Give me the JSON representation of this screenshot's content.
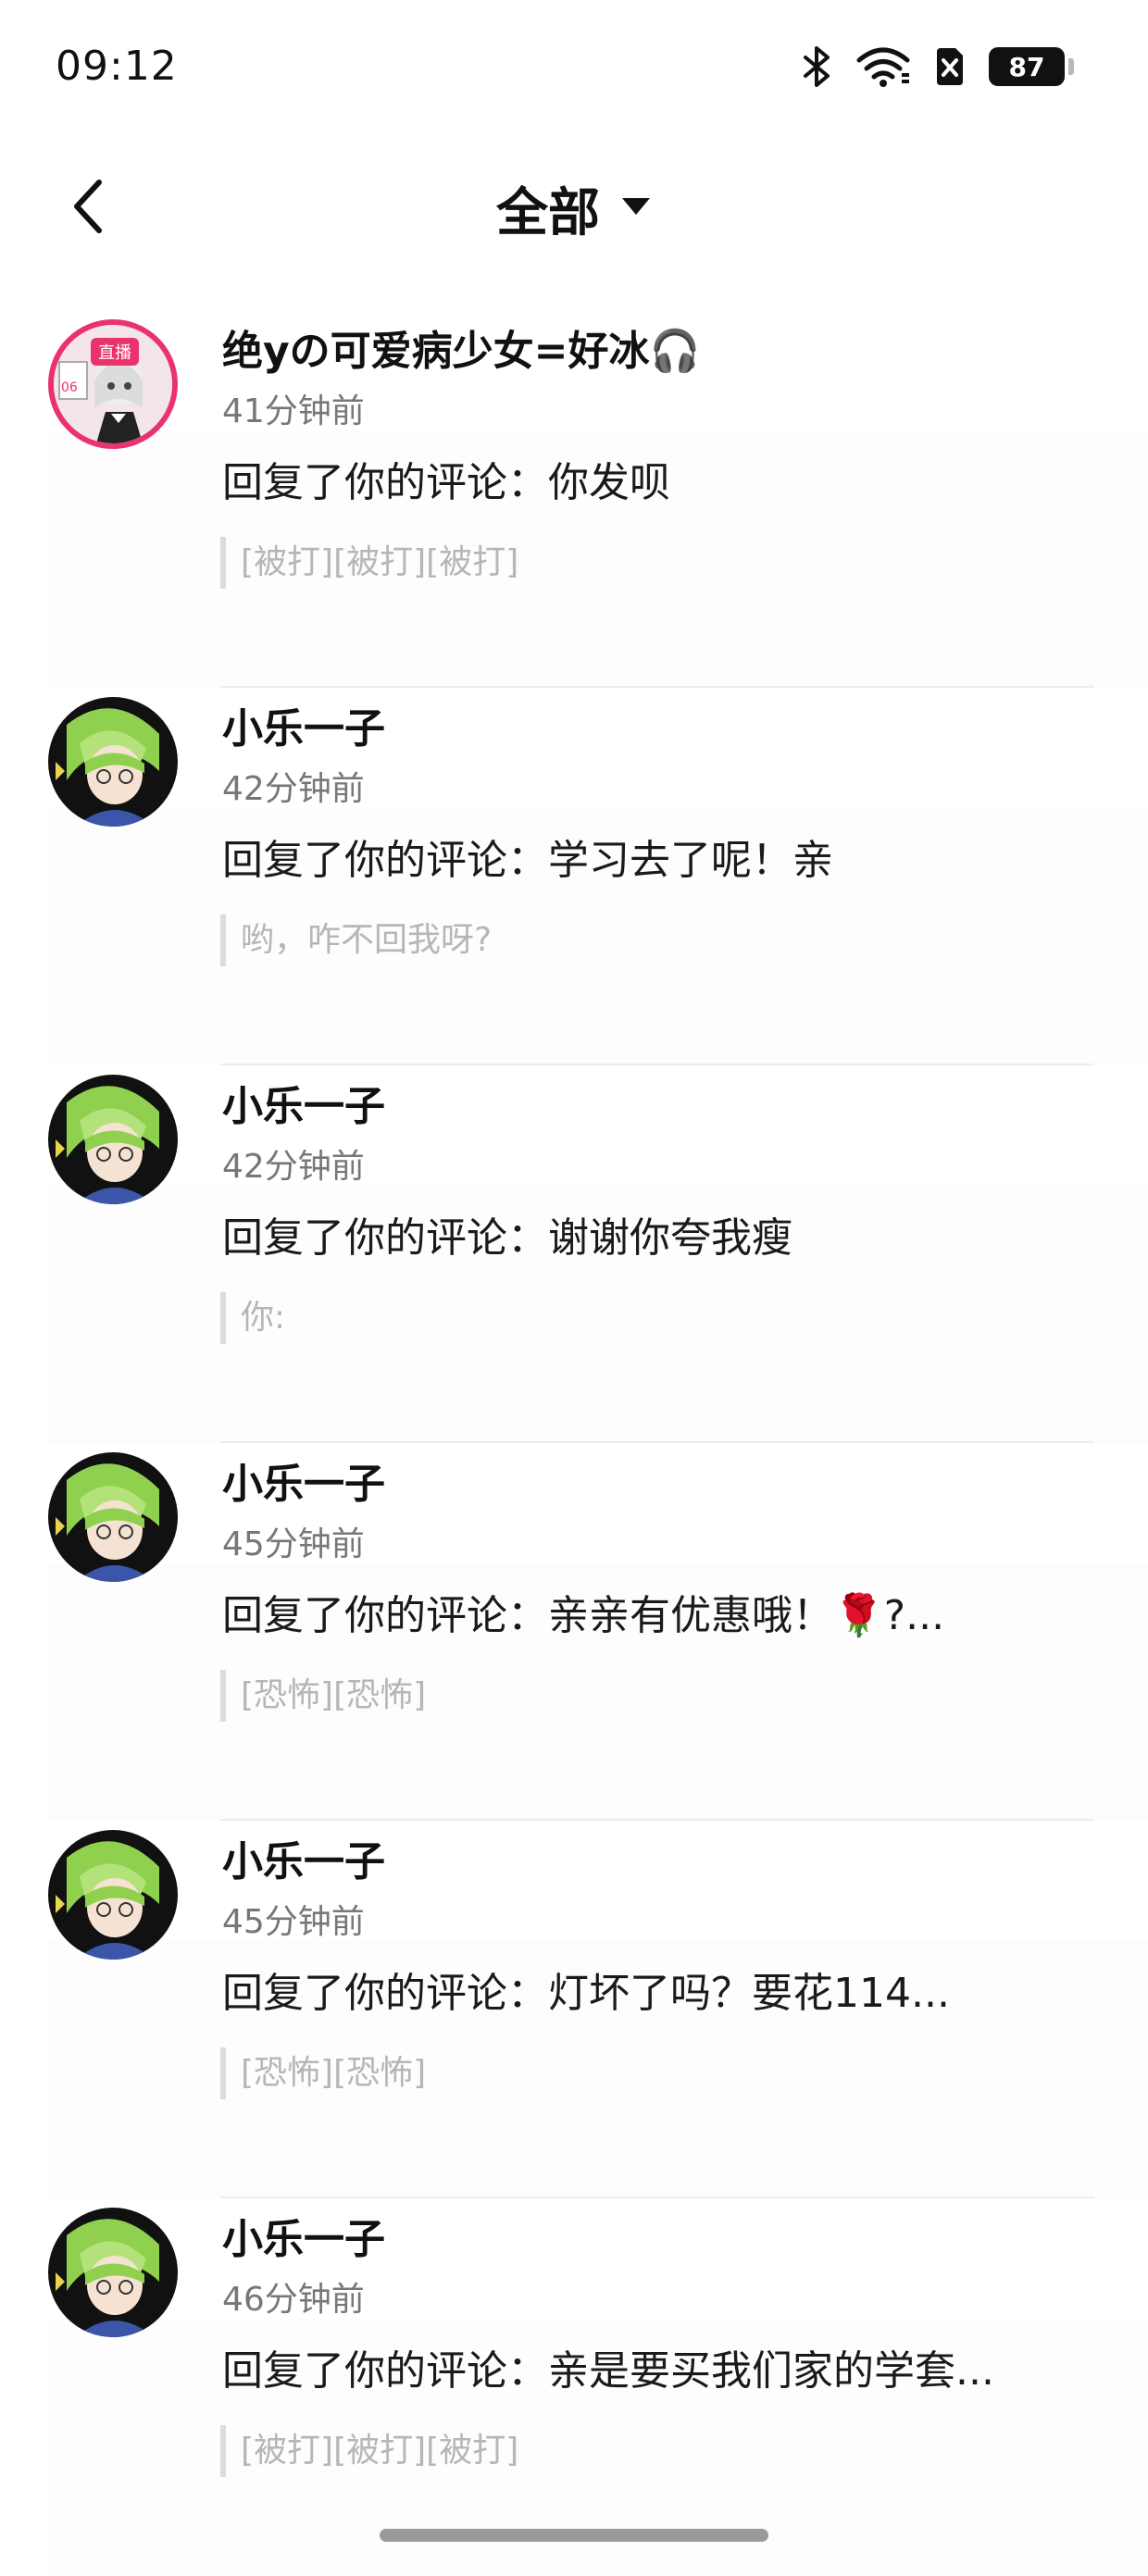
{
  "status_bar": {
    "time": "09:12",
    "battery": "87",
    "icons": [
      "bluetooth-icon",
      "wifi-icon",
      "sim-off-icon",
      "battery-icon"
    ]
  },
  "header": {
    "title": "全部",
    "back_icon": "chevron-left-icon",
    "dropdown_icon": "caret-down-icon"
  },
  "notifications": [
    {
      "username": "绝yの可爱病少女=好冰🎧",
      "time": "41分钟前",
      "reply": "回复了你的评论：你发呗",
      "quote": "[被打][被打][被打]",
      "avatar": "live",
      "live_label": "直播"
    },
    {
      "username": "小乐一子",
      "time": "42分钟前",
      "reply": "回复了你的评论：学习去了呢！亲",
      "quote": "哟，咋不回我呀?",
      "avatar": "anime"
    },
    {
      "username": "小乐一子",
      "time": "42分钟前",
      "reply": "回复了你的评论：谢谢你夸我瘦",
      "quote": "你:",
      "avatar": "anime"
    },
    {
      "username": "小乐一子",
      "time": "45分钟前",
      "reply": "回复了你的评论：亲亲有优惠哦！🌹?...",
      "quote": "[恐怖][恐怖]",
      "avatar": "anime"
    },
    {
      "username": "小乐一子",
      "time": "45分钟前",
      "reply": "回复了你的评论：灯坏了吗？要花114...",
      "quote": "[恐怖][恐怖]",
      "avatar": "anime"
    },
    {
      "username": "小乐一子",
      "time": "46分钟前",
      "reply": "回复了你的评论：亲是要买我们家的学套...",
      "quote": "[被打][被打][被打]",
      "avatar": "anime"
    }
  ],
  "colors": {
    "live_ring": "#e8336d",
    "quote_bar": "#dcdcdc",
    "divider": "#ededed",
    "anime_hair": "#8fd14f",
    "anime_bg": "#111111"
  }
}
